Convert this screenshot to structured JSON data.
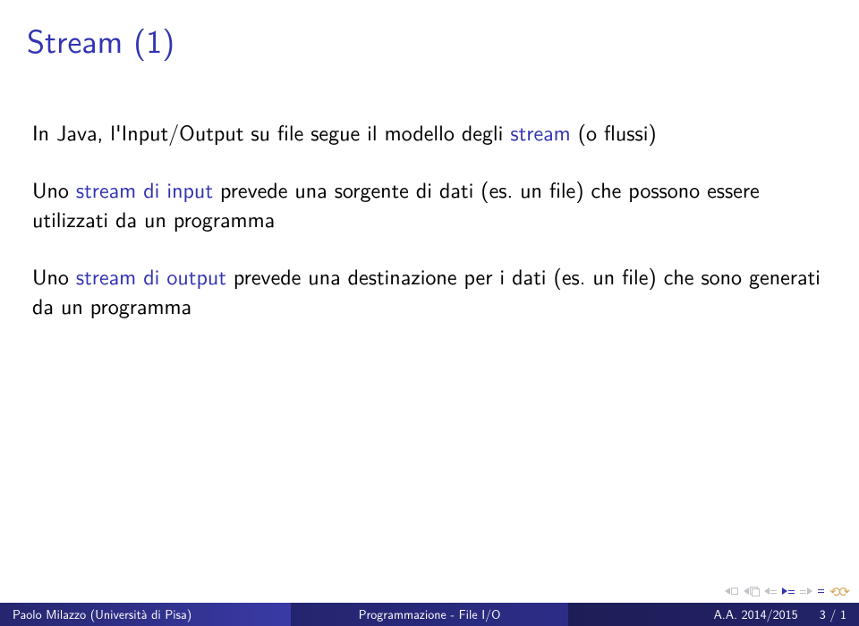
{
  "title": "Stream (1)",
  "body": {
    "p1_a": "In Java, l'Input/Output su file segue il modello degli ",
    "p1_term": "stream",
    "p1_b": " (o flussi)",
    "p2_a": "Uno ",
    "p2_term": "stream di input",
    "p2_b": " prevede una sorgente di dati (es. un file) che possono essere utilizzati da un programma",
    "p3_a": "Uno ",
    "p3_term": "stream di output",
    "p3_b": " prevede una destinazione per i dati (es. un file) che sono generati da un programma"
  },
  "footer": {
    "author": "Paolo Milazzo (Università di Pisa)",
    "course": "Programmazione - File I/O",
    "term": "A.A. 2014/2015",
    "page": "3 / 1"
  }
}
